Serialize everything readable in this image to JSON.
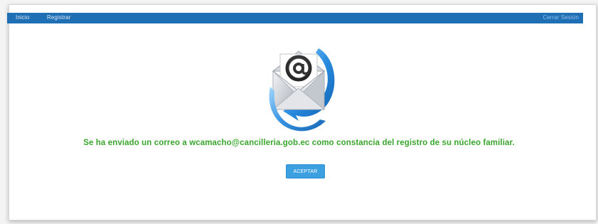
{
  "nav": {
    "items": [
      {
        "label": "Inicio"
      },
      {
        "label": "Registrar"
      }
    ],
    "logout_label": "Cerrar Sesión"
  },
  "confirmation": {
    "icon": "email-at-icon",
    "message": "Se ha enviado un correo a wcamacho@cancilleria.gob.ec como constancia del registro de su núcleo familiar.",
    "accept_label": "ACEPTAR"
  },
  "colors": {
    "navbar": "#1f6fb5",
    "message": "#3aa62e",
    "button": "#3c9fe0"
  }
}
